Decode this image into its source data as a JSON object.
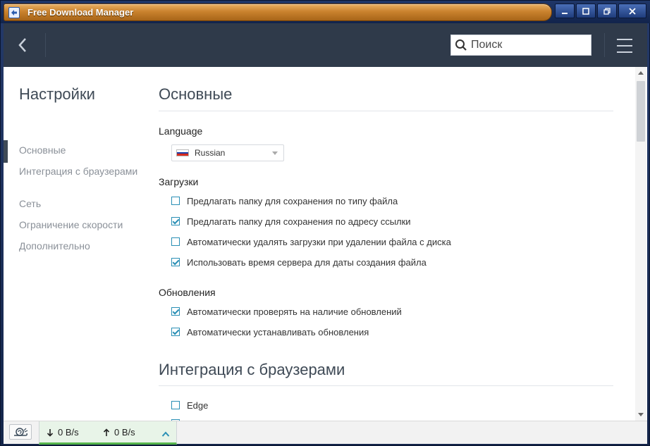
{
  "window": {
    "title": "Free Download Manager"
  },
  "header": {
    "search_placeholder": "Поиск"
  },
  "sidebar": {
    "title": "Настройки",
    "items": [
      {
        "label": "Основные"
      },
      {
        "label": "Интеграция с браузерами"
      },
      {
        "label": "Сеть"
      },
      {
        "label": "Ограничение скорости"
      },
      {
        "label": "Дополнительно"
      }
    ]
  },
  "main": {
    "section_general": "Основные",
    "language_label": "Language",
    "language_value": "Russian",
    "downloads_label": "Загрузки",
    "downloads_options": [
      {
        "label": "Предлагать папку для сохранения по типу файла",
        "checked": false
      },
      {
        "label": "Предлагать папку для сохранения по адресу ссылки",
        "checked": true
      },
      {
        "label": "Автоматически удалять загрузки при удалении файла с диска",
        "checked": false
      },
      {
        "label": "Использовать время сервера для даты создания файла",
        "checked": true
      }
    ],
    "updates_label": "Обновления",
    "updates_options": [
      {
        "label": "Автоматически проверять на наличие обновлений",
        "checked": true
      },
      {
        "label": "Автоматически устанавливать обновления",
        "checked": true
      }
    ],
    "section_browser": "Интеграция с браузерами",
    "browser_options": [
      {
        "label": "Edge",
        "checked": false
      }
    ]
  },
  "statusbar": {
    "download_speed": "0 B/s",
    "upload_speed": "0 B/s"
  },
  "colors": {
    "accent": "#2a8fb5",
    "header_bg": "#2f3a4a",
    "status_green": "#55b54a"
  }
}
